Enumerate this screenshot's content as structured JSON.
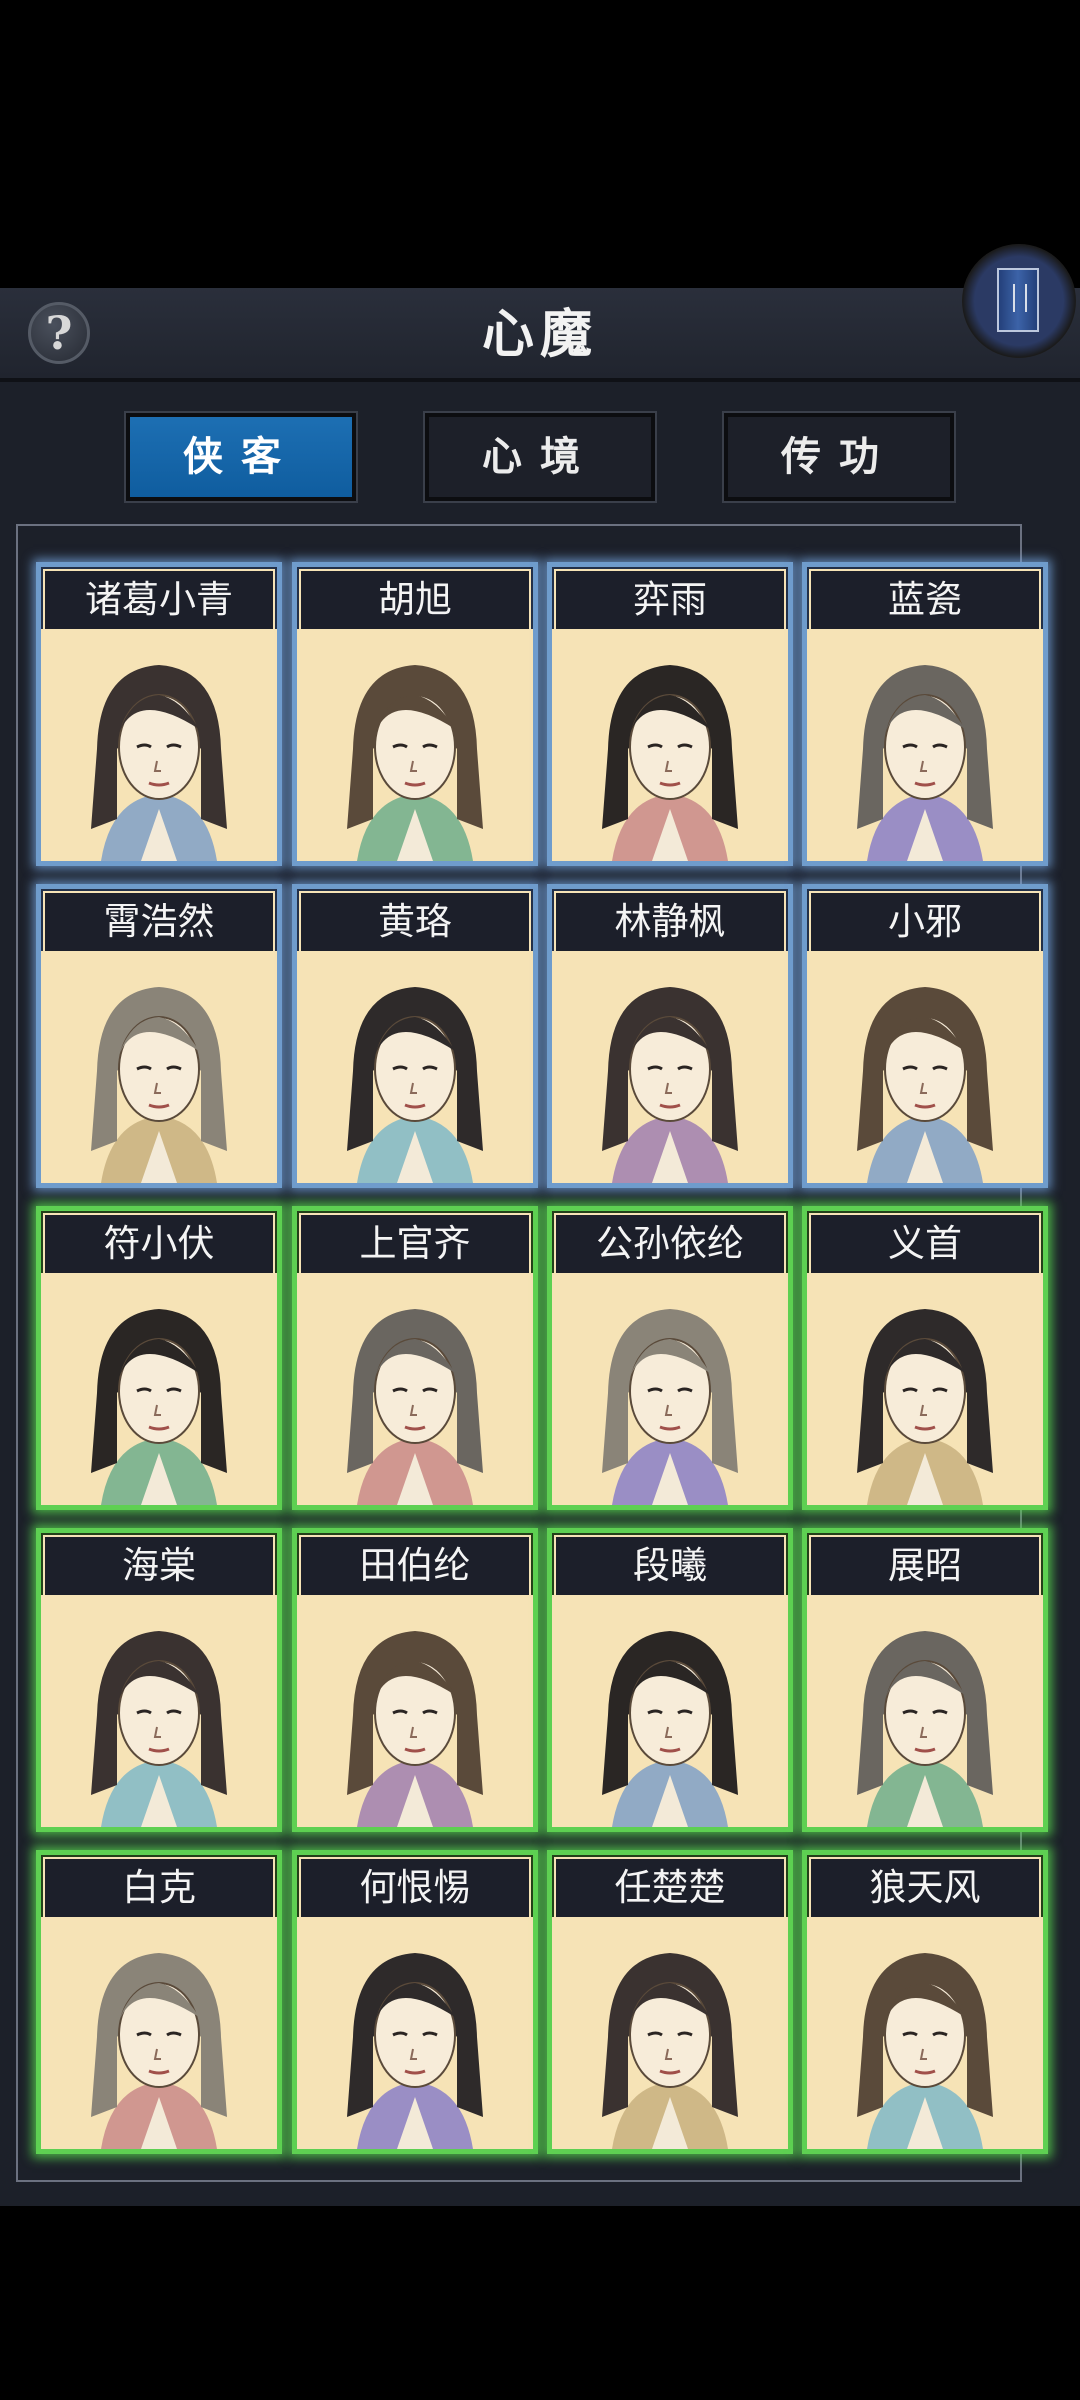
{
  "header": {
    "title": "心魔",
    "help_icon": "question-mark-icon",
    "book_icon": "book-icon"
  },
  "tabs": [
    {
      "label": "侠客",
      "active": true
    },
    {
      "label": "心境",
      "active": false
    },
    {
      "label": "传功",
      "active": false
    }
  ],
  "colors": {
    "active_tab": "#1d6fb3",
    "blue_tier_border": "#6f9ccc",
    "green_tier_border": "#5ed052",
    "card_background": "#f6e3b6"
  },
  "characters": [
    {
      "name": "诸葛小青",
      "tier": "blue"
    },
    {
      "name": "胡旭",
      "tier": "blue"
    },
    {
      "name": "弈雨",
      "tier": "blue"
    },
    {
      "name": "蓝瓷",
      "tier": "blue"
    },
    {
      "name": "霄浩然",
      "tier": "blue"
    },
    {
      "name": "黄珞",
      "tier": "blue"
    },
    {
      "name": "林静枫",
      "tier": "blue"
    },
    {
      "name": "小邪",
      "tier": "blue"
    },
    {
      "name": "符小伏",
      "tier": "green"
    },
    {
      "name": "上官齐",
      "tier": "green"
    },
    {
      "name": "公孙依纶",
      "tier": "green"
    },
    {
      "name": "义首",
      "tier": "green"
    },
    {
      "name": "海棠",
      "tier": "green"
    },
    {
      "name": "田伯纶",
      "tier": "green"
    },
    {
      "name": "段曦",
      "tier": "green"
    },
    {
      "name": "展昭",
      "tier": "green"
    },
    {
      "name": "白克",
      "tier": "green"
    },
    {
      "name": "何恨惕",
      "tier": "green"
    },
    {
      "name": "任楚楚",
      "tier": "green"
    },
    {
      "name": "狼天风",
      "tier": "green"
    }
  ]
}
